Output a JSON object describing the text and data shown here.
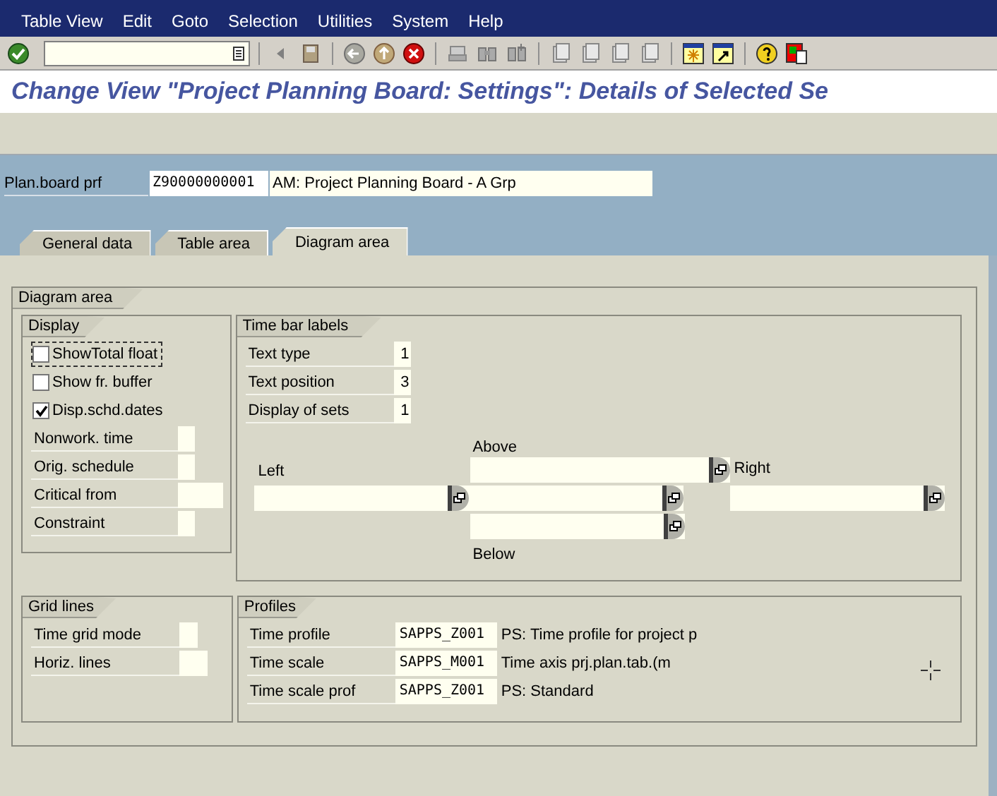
{
  "menu_bar": [
    {
      "label": "Table View"
    },
    {
      "label": "Edit"
    },
    {
      "label": "Goto"
    },
    {
      "label": "Selection"
    },
    {
      "label": "Utilities"
    },
    {
      "label": "System"
    },
    {
      "label": "Help"
    }
  ],
  "window": {
    "title": "Change View \"Project Planning Board: Settings\": Details of Selected Se"
  },
  "header": {
    "label": "Plan.board prf",
    "value": "Z90000000001",
    "description": "AM: Project Planning Board - A Grp"
  },
  "tabs": [
    {
      "label": "General data",
      "selected": false
    },
    {
      "label": "Table area",
      "selected": false
    },
    {
      "label": "Diagram area",
      "selected": true
    }
  ],
  "diagram_area": {
    "title": "Diagram area",
    "display": {
      "title": "Display",
      "items": [
        {
          "kind": "checkbox",
          "label": "ShowTotal float",
          "checked": false,
          "focused": true
        },
        {
          "kind": "checkbox",
          "label": "Show fr. buffer",
          "checked": false,
          "focused": false
        },
        {
          "kind": "checkbox",
          "label": "Disp.schd.dates",
          "checked": true,
          "focused": false
        },
        {
          "kind": "field",
          "label": "Nonwork. time"
        },
        {
          "kind": "field",
          "label": "Orig. schedule"
        },
        {
          "kind": "field",
          "label": "Critical from"
        },
        {
          "kind": "field",
          "label": "Constraint"
        }
      ]
    },
    "time_bar_labels": {
      "title": "Time bar labels",
      "fields": [
        {
          "label": "Text type",
          "value": "1"
        },
        {
          "label": "Text position",
          "value": "3"
        },
        {
          "label": "Display of sets",
          "value": "1"
        }
      ],
      "positions": {
        "above": "Above",
        "left": "Left",
        "right": "Right",
        "below": "Below"
      }
    },
    "grid_lines": {
      "title": "Grid lines",
      "fields": [
        {
          "label": "Time grid mode"
        },
        {
          "label": "Horiz. lines"
        }
      ]
    },
    "profiles": {
      "title": "Profiles",
      "fields": [
        {
          "label": "Time profile",
          "value": "SAPPS_Z001",
          "description": "PS: Time profile for project p"
        },
        {
          "label": "Time scale",
          "value": "SAPPS_M001",
          "description": "Time axis prj.plan.tab.(m"
        },
        {
          "label": "Time scale prof",
          "value": "SAPPS_Z001",
          "description": "PS: Standard"
        }
      ]
    }
  }
}
